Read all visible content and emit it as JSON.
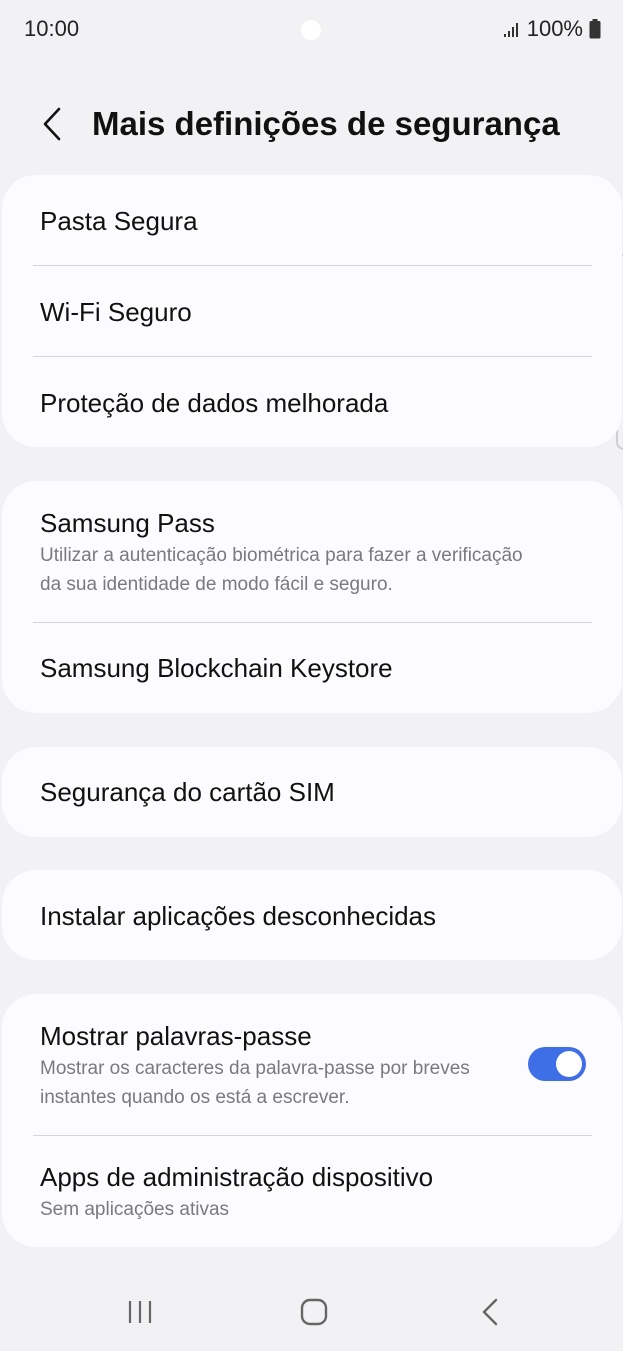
{
  "status_bar": {
    "time": "10:00",
    "battery": "100%",
    "signal_icon": "signal-icon",
    "battery_icon": "battery-icon"
  },
  "header": {
    "title": "Mais definições de segurança",
    "back_icon": "chevron-left-icon"
  },
  "groups": [
    {
      "items": [
        {
          "title": "Pasta Segura"
        },
        {
          "title": "Wi-Fi Seguro"
        },
        {
          "title": "Proteção de dados melhorada"
        }
      ]
    },
    {
      "items": [
        {
          "title": "Samsung Pass",
          "subtitle": "Utilizar a autenticação biométrica para fazer a verificação da sua identidade de modo fácil e seguro."
        },
        {
          "title": "Samsung Blockchain Keystore"
        }
      ]
    },
    {
      "items": [
        {
          "title": "Segurança do cartão SIM"
        }
      ]
    },
    {
      "items": [
        {
          "title": "Instalar aplicações desconhecidas"
        }
      ]
    },
    {
      "items": [
        {
          "title": "Mostrar palavras-passe",
          "subtitle": "Mostrar os caracteres da palavra-passe por breves instantes quando os está a escrever.",
          "toggle_on": true
        },
        {
          "title": "Apps de administração dispositivo",
          "subtitle": "Sem aplicações ativas"
        }
      ]
    }
  ],
  "nav_bar": {
    "recents_icon": "recents-icon",
    "home_icon": "home-icon",
    "back_icon": "back-icon"
  },
  "colors": {
    "background": "#f2f2f4",
    "card": "#fcfcfe",
    "toggle_on": "#3e6fe6",
    "subtitle": "#7a7a7e"
  }
}
